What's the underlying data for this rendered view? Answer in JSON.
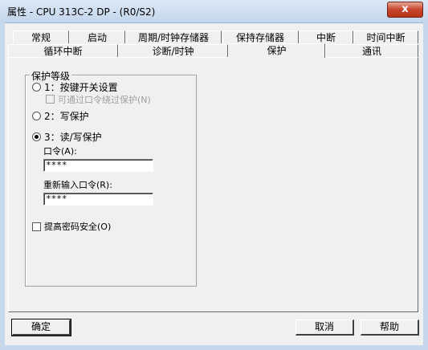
{
  "window": {
    "title": "属性 - CPU 313C-2 DP - (R0/S2)",
    "close_label": "x"
  },
  "tabs_row1": [
    "常规",
    "启动",
    "周期/时钟存储器",
    "保持存储器",
    "中断",
    "时间中断"
  ],
  "tabs_row2": [
    "循环中断",
    "诊断/时钟",
    "保护",
    "通讯"
  ],
  "active_tab": "保护",
  "protection": {
    "group_title": "保护等级",
    "level1_label": "1：按键开关设置",
    "level1_sub_label": "可通过口令绕过保护(N)",
    "level2_label": "2：写保护",
    "level3_label": "3：读/写保护",
    "selected_level": 3,
    "password_label": "口令(A):",
    "password_value": "****",
    "reenter_label": "重新输入口令(R):",
    "reenter_value": "****",
    "enhance_label": "提高密码安全(O)"
  },
  "buttons": {
    "ok": "确定",
    "cancel": "取消",
    "help": "帮助"
  }
}
